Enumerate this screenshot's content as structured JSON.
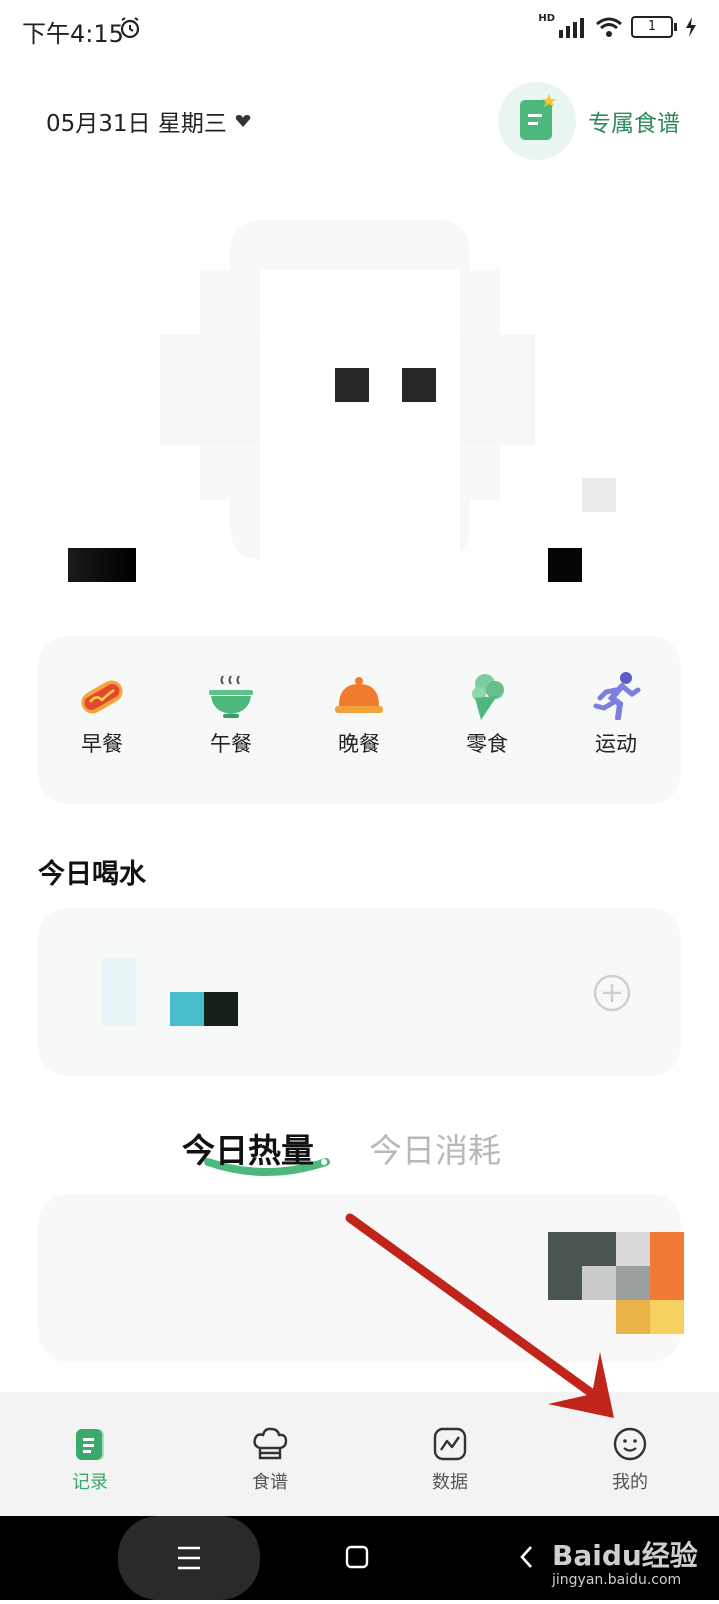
{
  "status_bar": {
    "time": "下午4:15",
    "network": "HD",
    "battery": "1"
  },
  "header": {
    "date": "05月31日 星期三",
    "recipe_button": "专属食谱"
  },
  "meals": [
    {
      "label": "早餐",
      "icon": "hotdog-icon"
    },
    {
      "label": "午餐",
      "icon": "bowl-icon"
    },
    {
      "label": "晚餐",
      "icon": "cloche-icon"
    },
    {
      "label": "零食",
      "icon": "icecream-icon"
    },
    {
      "label": "运动",
      "icon": "running-icon"
    }
  ],
  "water": {
    "title": "今日喝水"
  },
  "tabs": {
    "calories": "今日热量",
    "burned": "今日消耗"
  },
  "bottom_nav": [
    {
      "label": "记录",
      "icon": "record-icon",
      "active": true
    },
    {
      "label": "食谱",
      "icon": "chef-hat-icon",
      "active": false
    },
    {
      "label": "数据",
      "icon": "chart-icon",
      "active": false
    },
    {
      "label": "我的",
      "icon": "smile-icon",
      "active": false
    }
  ],
  "watermark": {
    "brand": "Baidu经验",
    "url": "jingyan.baidu.com"
  },
  "colors": {
    "accent": "#2f8a5b",
    "active_nav": "#3aa96b",
    "arrow": "#c0241a"
  }
}
